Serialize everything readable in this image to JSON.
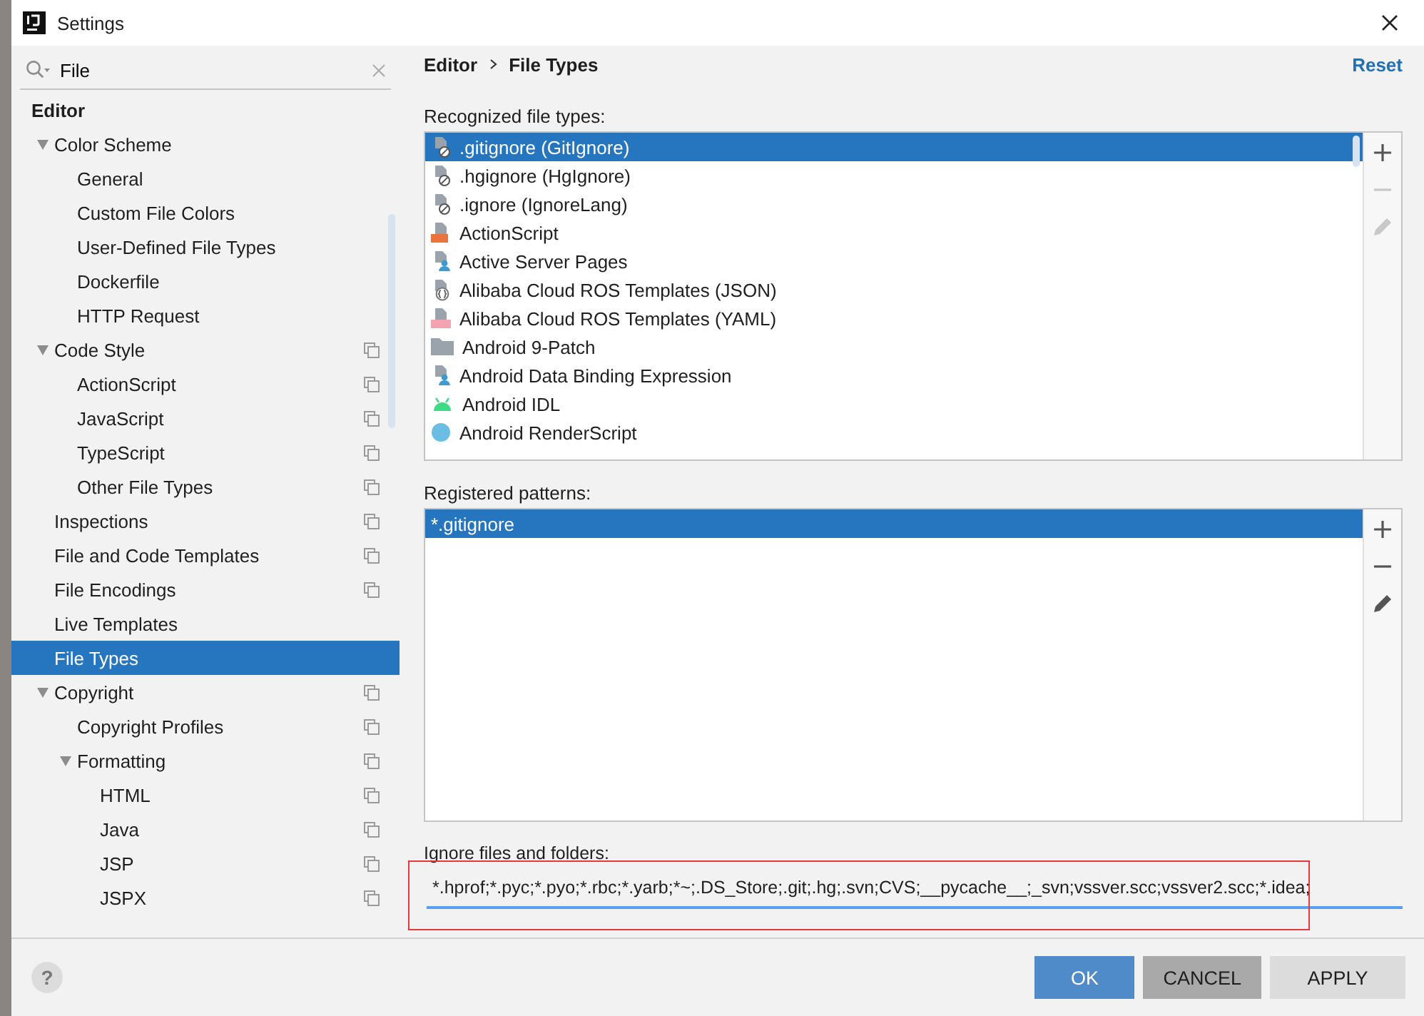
{
  "window": {
    "title": "Settings"
  },
  "search": {
    "value": "File"
  },
  "tree": [
    {
      "label": "Editor",
      "bold": true,
      "children": [
        {
          "label": "Color Scheme",
          "expanded": true,
          "scoped": false,
          "children": [
            {
              "label": "General",
              "scoped": false
            },
            {
              "label": "Custom File Colors",
              "scoped": false
            },
            {
              "label": "User-Defined File Types",
              "scoped": false
            },
            {
              "label": "Dockerfile",
              "scoped": false
            },
            {
              "label": "HTTP Request",
              "scoped": false
            }
          ]
        },
        {
          "label": "Code Style",
          "expanded": true,
          "scoped": true,
          "children": [
            {
              "label": "ActionScript",
              "scoped": true
            },
            {
              "label": "JavaScript",
              "scoped": true
            },
            {
              "label": "TypeScript",
              "scoped": true
            },
            {
              "label": "Other File Types",
              "scoped": true
            }
          ]
        },
        {
          "label": "Inspections",
          "scoped": true
        },
        {
          "label": "File and Code Templates",
          "scoped": true
        },
        {
          "label": "File Encodings",
          "scoped": true
        },
        {
          "label": "Live Templates",
          "scoped": false
        },
        {
          "label": "File Types",
          "scoped": false,
          "selected": true
        },
        {
          "label": "Copyright",
          "expanded": true,
          "scoped": true,
          "children": [
            {
              "label": "Copyright Profiles",
              "scoped": true
            },
            {
              "label": "Formatting",
              "expanded": true,
              "scoped": true,
              "children": [
                {
                  "label": "HTML",
                  "scoped": true
                },
                {
                  "label": "Java",
                  "scoped": true
                },
                {
                  "label": "JSP",
                  "scoped": true
                },
                {
                  "label": "JSPX",
                  "scoped": true
                }
              ]
            }
          ]
        }
      ]
    }
  ],
  "breadcrumb": [
    "Editor",
    "File Types"
  ],
  "reset": "Reset",
  "recognized": {
    "label": "Recognized file types:",
    "items": [
      {
        "name": ".gitignore (GitIgnore)",
        "kind": "ignore",
        "selected": true
      },
      {
        "name": ".hgignore (HgIgnore)",
        "kind": "ignore",
        "selected": false
      },
      {
        "name": ".ignore (IgnoreLang)",
        "kind": "ignore",
        "selected": false
      },
      {
        "name": "ActionScript",
        "kind": "actionscript",
        "selected": false
      },
      {
        "name": "Active Server Pages",
        "kind": "person",
        "selected": false
      },
      {
        "name": "Alibaba Cloud ROS Templates (JSON)",
        "kind": "json",
        "selected": false
      },
      {
        "name": "Alibaba Cloud ROS Templates (YAML)",
        "kind": "yaml",
        "selected": false
      },
      {
        "name": "Android 9-Patch",
        "kind": "folder",
        "selected": false
      },
      {
        "name": "Android Data Binding Expression",
        "kind": "person",
        "selected": false
      },
      {
        "name": "Android IDL",
        "kind": "android",
        "selected": false
      },
      {
        "name": "Android RenderScript",
        "kind": "renderscript",
        "selected": false
      }
    ]
  },
  "patterns": {
    "label": "Registered patterns:",
    "items": [
      {
        "name": "*.gitignore",
        "selected": true
      }
    ]
  },
  "ignore": {
    "label": "Ignore files and folders:",
    "value": "*.hprof;*.pyc;*.pyo;*.rbc;*.yarb;*~;.DS_Store;.git;.hg;.svn;CVS;__pycache__;_svn;vssver.scc;vssver2.scc;*.idea;"
  },
  "help": "?",
  "buttons": [
    {
      "label": "OK",
      "kind": "primary"
    },
    {
      "label": "CANCEL",
      "kind": "pressed"
    },
    {
      "label": "APPLY",
      "kind": "normal"
    }
  ]
}
